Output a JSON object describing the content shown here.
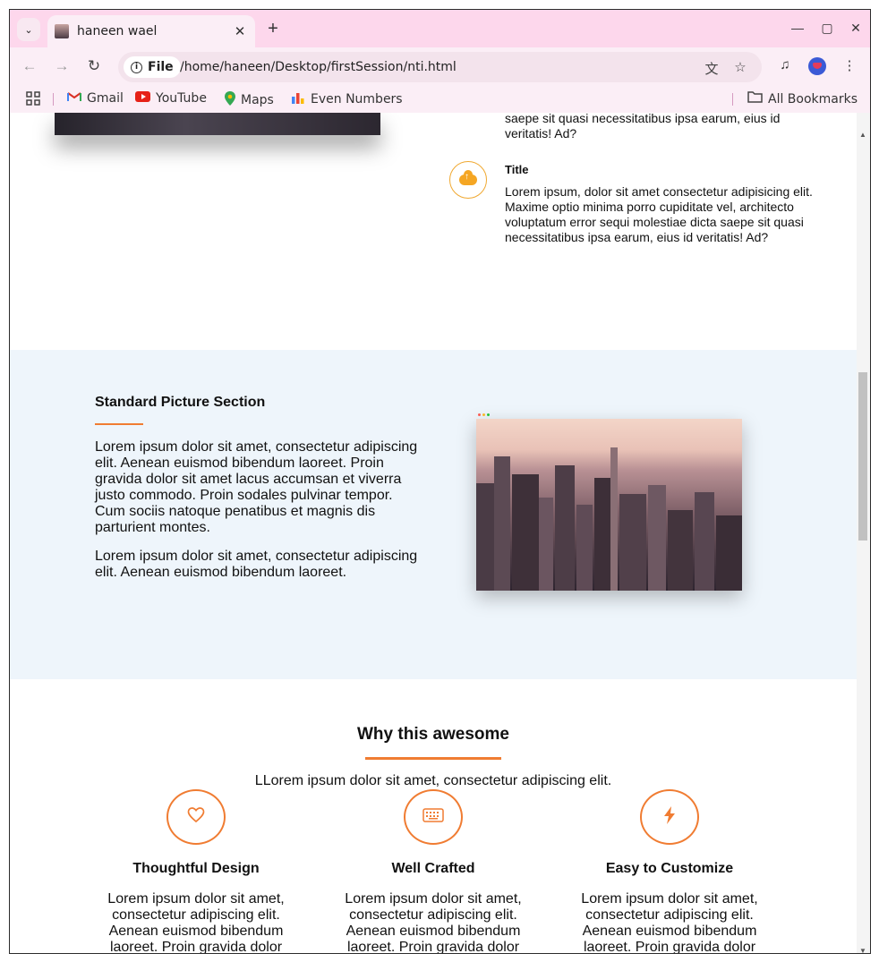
{
  "browser": {
    "tab_title": "haneen wael",
    "site_info_label": "File",
    "url": "/home/haneen/Desktop/firstSession/nti.html",
    "bookmarks": [
      {
        "label": "Gmail",
        "icon": "gmail-icon"
      },
      {
        "label": "YouTube",
        "icon": "youtube-icon"
      },
      {
        "label": "Maps",
        "icon": "maps-icon"
      },
      {
        "label": "Even Numbers",
        "icon": "chart-icon"
      }
    ],
    "all_bookmarks_label": "All Bookmarks"
  },
  "features": {
    "prev_text": "saepe sit quasi necessitatibus ipsa earum, eius id veritatis! Ad?",
    "item": {
      "title": "Title",
      "icon": "cloud-upload-icon",
      "text": "Lorem ipsum, dolor sit amet consectetur adipisicing elit. Maxime optio minima porro cupiditate vel, architecto voluptatum error sequi molestiae dicta saepe sit quasi necessitatibus ipsa earum, eius id veritatis! Ad?"
    }
  },
  "standard_section": {
    "heading": "Standard Picture Section",
    "para1": "Lorem ipsum dolor sit amet, consectetur adipiscing elit. Aenean euismod bibendum laoreet. Proin gravida dolor sit amet lacus accumsan et viverra justo commodo. Proin sodales pulvinar tempor. Cum sociis natoque penatibus et magnis dis parturient montes.",
    "para2": "Lorem ipsum dolor sit amet, consectetur adipiscing elit. Aenean euismod bibendum laoreet."
  },
  "why": {
    "title": "Why this awesome",
    "subtitle": "LLorem ipsum dolor sit amet, consectetur adipiscing elit.",
    "cards": [
      {
        "title": "Thoughtful Design",
        "icon": "heart-icon",
        "text": "Lorem ipsum dolor sit amet, consectetur adipiscing elit. Aenean euismod bibendum laoreet. Proin gravida dolor sit amet lacus accumsan et"
      },
      {
        "title": "Well Crafted",
        "icon": "keyboard-icon",
        "text": "Lorem ipsum dolor sit amet, consectetur adipiscing elit. Aenean euismod bibendum laoreet. Proin gravida dolor sit amet lacus accumsan et"
      },
      {
        "title": "Easy to Customize",
        "icon": "bolt-icon",
        "text": "Lorem ipsum dolor sit amet, consectetur adipiscing elit. Aenean euismod bibendum laoreet. Proin gravida dolor sit amet lacus accumsan et"
      }
    ]
  },
  "colors": {
    "accent": "#f07c32",
    "feature_icon": "#f5a623",
    "section_bg": "#eef5fb",
    "tabstrip_bg": "#fdd7ec"
  }
}
